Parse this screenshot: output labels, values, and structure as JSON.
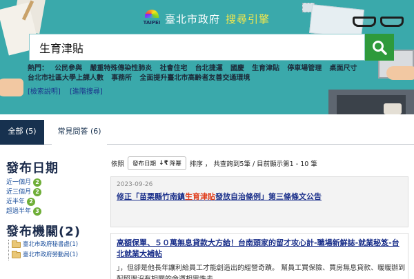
{
  "header": {
    "logo_word": "TAIPEI",
    "site_name": "臺北市政府",
    "engine_name": "搜尋引擎",
    "colors": {
      "background": "#3aa9ab",
      "engine_name": "#f6e84a",
      "search_button": "#2e9a3c"
    }
  },
  "search": {
    "value": "生育津貼",
    "button_icon": "magnifier-icon"
  },
  "hot": {
    "label": "熱門：",
    "items": [
      "公民參與",
      "嚴重特殊傳染性肺炎",
      "社會住宅",
      "台北捷運",
      "國慶",
      "生育津貼",
      "停車場管理",
      "桌面尺寸",
      "台北市社區大學上課人數",
      "事務所",
      "全面提升臺北市高齡者友善交通環境"
    ]
  },
  "help_links": [
    "[檢索說明]",
    "[進階搜尋]"
  ],
  "tabs": [
    {
      "label": "全部 (5)",
      "active": true
    },
    {
      "label": "常見問答 (6)",
      "active": false
    }
  ],
  "facets": {
    "date_title": "發布日期",
    "date_items": [
      {
        "label": "近一個月",
        "count": "2"
      },
      {
        "label": "近三個月",
        "count": "2"
      },
      {
        "label": "近半年",
        "count": "2"
      },
      {
        "label": "超過半年",
        "count": "3"
      }
    ],
    "org_title": "發布機關(2)",
    "org_items": [
      {
        "label": "臺北市政府秘書處(1)"
      },
      {
        "label": "臺北市政府勞動局(1)"
      }
    ],
    "badge_color": "#6fae38"
  },
  "results_bar": {
    "prefix": "依照",
    "sort_field": "發布日期",
    "sort_icon": "sort-descending-icon",
    "sort_icon_glyph": "↓₹",
    "sort_order": "降冪",
    "summary": "排序 ， 共查詢到5筆 / 目前顯示第1 - 10 筆"
  },
  "results": [
    {
      "date": "2023-09-26",
      "title_before": "修正「苗栗縣竹南鎮",
      "title_highlight": "生育津貼",
      "title_after": "發放自治條例」第三條條文公告"
    },
    {
      "title": "高額保單、５０萬無息貸款大方給！台南頭家的留才攻心計-職場新鮮誌-就業秘笈-台北就業大補帖",
      "snippet": "」，但卻是他長年讓利給員工才能創造出的經營奇蹟。 幫員工買保險、買房無息貸款、暖暖辦到 配照理沒有相關的命運相思性去..."
    }
  ]
}
